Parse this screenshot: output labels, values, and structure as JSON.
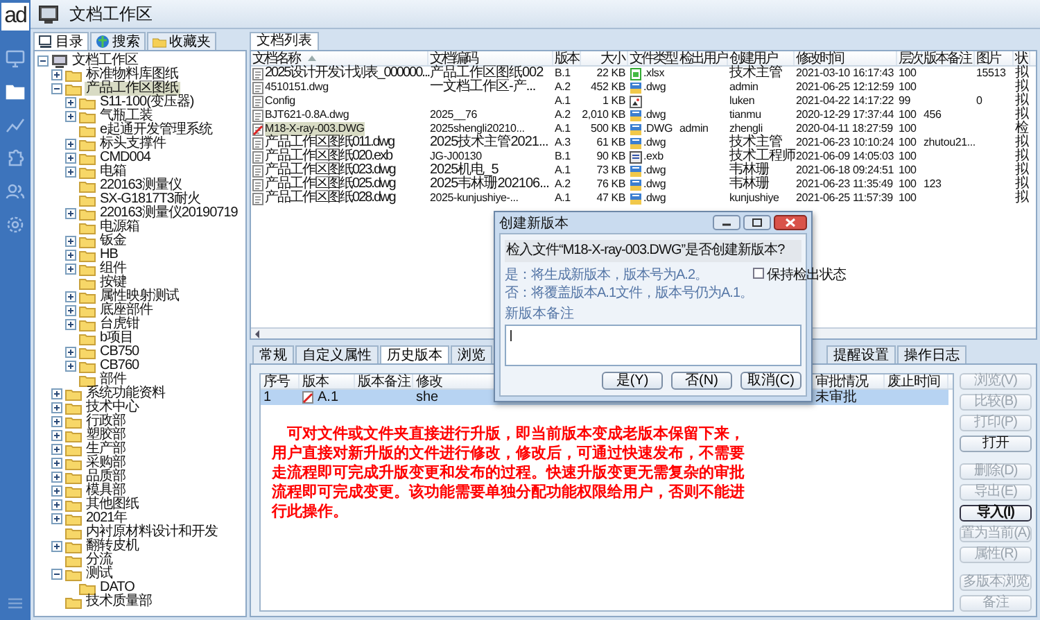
{
  "logo": "ad",
  "nav": [
    {
      "kind": "monitor",
      "selected": false
    },
    {
      "kind": "folder",
      "selected": true
    },
    {
      "kind": "chart",
      "selected": false
    },
    {
      "kind": "puzzle",
      "selected": false
    },
    {
      "kind": "users",
      "selected": false
    },
    {
      "kind": "gear",
      "selected": false
    }
  ],
  "window": {
    "title": "文档工作区"
  },
  "left_tabs": [
    {
      "label": "目录",
      "kind": "catalog",
      "selected": true
    },
    {
      "label": "搜索",
      "kind": "search",
      "selected": false
    },
    {
      "label": "收藏夹",
      "kind": "favorite",
      "selected": false
    }
  ],
  "tree": [
    {
      "label": "文档工作区",
      "kind": "root",
      "expanded": true,
      "selected": false,
      "children": [
        {
          "label": "标准物料库图纸",
          "expanded": false,
          "selected": false
        },
        {
          "label": "产品工作区图纸",
          "expanded": true,
          "selected": true,
          "children": [
            {
              "label": "S11-100(变压器)",
              "expanded": false,
              "selected": false
            },
            {
              "label": "气瓶工装",
              "expanded": false,
              "selected": false
            },
            {
              "label": "e起通开发管理系统",
              "selected": false
            },
            {
              "label": "标头支撑件",
              "expanded": false,
              "selected": false
            },
            {
              "label": "CMD004",
              "expanded": false,
              "selected": false
            },
            {
              "label": "电箱",
              "expanded": false,
              "selected": false
            },
            {
              "label": "220163测量仪",
              "selected": false
            },
            {
              "label": "SX-G1817T3耐火",
              "selected": false
            },
            {
              "label": "220163测量仪20190719",
              "expanded": false,
              "selected": false
            },
            {
              "label": "电源箱",
              "selected": false
            },
            {
              "label": "钣金",
              "expanded": false,
              "selected": false
            },
            {
              "label": "HB",
              "expanded": false,
              "selected": false
            },
            {
              "label": "组件",
              "expanded": false,
              "selected": false
            },
            {
              "label": "按键",
              "selected": false
            },
            {
              "label": "属性映射测试",
              "expanded": false,
              "selected": false
            },
            {
              "label": "底座部件",
              "expanded": false,
              "selected": false
            },
            {
              "label": "台虎钳",
              "expanded": false,
              "selected": false
            },
            {
              "label": "b项目",
              "selected": false
            },
            {
              "label": "CB750",
              "expanded": false,
              "selected": false
            },
            {
              "label": "CB760",
              "expanded": false,
              "selected": false
            },
            {
              "label": "部件",
              "selected": false
            }
          ]
        },
        {
          "label": "系统功能资料",
          "expanded": false,
          "selected": false
        },
        {
          "label": "技术中心",
          "expanded": false,
          "selected": false
        },
        {
          "label": "行政部",
          "expanded": false,
          "selected": false
        },
        {
          "label": "塑胶部",
          "expanded": false,
          "selected": false
        },
        {
          "label": "生产部",
          "expanded": false,
          "selected": false
        },
        {
          "label": "采购部",
          "expanded": false,
          "selected": false
        },
        {
          "label": "品质部",
          "expanded": false,
          "selected": false
        },
        {
          "label": "模具部",
          "expanded": false,
          "selected": false
        },
        {
          "label": "其他图纸",
          "expanded": false,
          "selected": false
        },
        {
          "label": "2021年",
          "expanded": false,
          "selected": false
        },
        {
          "label": "内衬原材料设计和开发",
          "selected": false
        },
        {
          "label": "翻转皮机",
          "expanded": false,
          "selected": false
        },
        {
          "label": "分流",
          "selected": false
        },
        {
          "label": "测试",
          "expanded": true,
          "selected": false,
          "children": [
            {
              "label": "DATO",
              "selected": false
            }
          ]
        },
        {
          "label": "技术质量部",
          "selected": false
        }
      ]
    }
  ],
  "list_tab": {
    "label": "文档列表"
  },
  "file_table": {
    "columns": [
      "文档名称",
      "文档编码",
      "版本",
      "大小",
      "文件类型",
      "检出用户",
      "创建用户",
      "修改时间",
      "层次",
      "版本备注",
      "图片",
      "状"
    ],
    "rows": [
      {
        "doc_name": "2025设计开发计划表_000000...",
        "doc_code": "产品工作区图纸002",
        "version": "B.1",
        "size": "22 KB",
        "kind": "excel",
        "file_type": ".xlsx",
        "creator": "技术主管",
        "modified": "2021-03-10 16:17:43",
        "tier": "100",
        "image": "15513",
        "column_12": "拟",
        "checked_out": false,
        "selected": false
      },
      {
        "doc_name": "4510151.dwg",
        "doc_code": "一文档工作区-产...",
        "version": "A.2",
        "size": "452 KB",
        "kind": "dwg",
        "file_type": ".dwg",
        "creator": "admin",
        "modified": "2021-06-25 12:12:59",
        "tier": "100",
        "column_12": "拟",
        "checked_out": false,
        "selected": false
      },
      {
        "doc_name": "Config",
        "version": "A.1",
        "size": "1 KB",
        "kind": "image",
        "creator": "luken",
        "modified": "2021-04-22 14:17:22",
        "tier": "99",
        "image": "0",
        "column_12": "拟",
        "checked_out": false,
        "selected": false
      },
      {
        "doc_name": "BJT621-0.8A.dwg",
        "doc_code": "2025__76",
        "version": "A.2",
        "size": "2,010 KB",
        "kind": "dwg",
        "file_type": ".dwg",
        "creator": "tianmu",
        "modified": "2020-12-29 17:37:44",
        "tier": "100",
        "version_note": "456",
        "column_12": "拟",
        "checked_out": false,
        "selected": false
      },
      {
        "doc_name": "M18-X-ray-003.DWG",
        "doc_code": "2025shengli20210...",
        "version": "A.1",
        "size": "500 KB",
        "kind": "dwg",
        "file_type": ".DWG",
        "checkout_user": "admin",
        "creator": "zhengli",
        "modified": "2020-04-11 18:27:59",
        "tier": "100",
        "column_12": "检",
        "checked_out": true,
        "selected": true
      },
      {
        "doc_name": "产品工作区图纸011.dwg",
        "doc_code": "2025技术主管2021...",
        "version": "A.3",
        "size": "61 KB",
        "kind": "dwg",
        "file_type": ".dwg",
        "creator": "技术主管",
        "modified": "2021-06-23 10:10:24",
        "tier": "100",
        "version_note": "zhutou21...",
        "column_12": "拟",
        "checked_out": false,
        "selected": false
      },
      {
        "doc_name": "产品工作区图纸020.exb",
        "doc_code": "JG-J00130",
        "version": "B.1",
        "size": "90 KB",
        "kind": "exb",
        "file_type": ".exb",
        "creator": "技术工程师",
        "modified": "2021-06-09 14:05:03",
        "tier": "100",
        "column_12": "拟",
        "checked_out": false,
        "selected": false
      },
      {
        "doc_name": "产品工作区图纸023.dwg",
        "doc_code": "2025机电_5",
        "version": "A.1",
        "size": "73 KB",
        "kind": "dwg",
        "file_type": ".dwg",
        "creator": "韦林珊",
        "modified": "2021-06-18 09:24:51",
        "tier": "100",
        "column_12": "拟",
        "checked_out": false,
        "selected": false
      },
      {
        "doc_name": "产品工作区图纸025.dwg",
        "doc_code": "2025韦林珊202106...",
        "version": "A.2",
        "size": "76 KB",
        "kind": "dwg",
        "file_type": ".dwg",
        "creator": "韦林珊",
        "modified": "2021-06-23 11:35:49",
        "tier": "100",
        "version_note": "123",
        "column_12": "拟",
        "checked_out": false,
        "selected": false
      },
      {
        "doc_name": "产品工作区图纸028.dwg",
        "doc_code": "2025-kunjushiye-...",
        "version": "A.1",
        "size": "47 KB",
        "kind": "dwg",
        "file_type": ".dwg",
        "creator": "kunjushiye",
        "modified": "2021-06-25 11:57:39",
        "tier": "100",
        "column_12": "拟",
        "checked_out": false,
        "selected": false
      }
    ]
  },
  "detail_tabs": [
    {
      "label": "常规",
      "selected": false
    },
    {
      "label": "自定义属性",
      "selected": false
    },
    {
      "label": "历史版本",
      "selected": true
    },
    {
      "label": "浏览",
      "selected": false
    },
    {
      "label": "提醒设置",
      "selected": false
    },
    {
      "label": "操作日志",
      "selected": false
    }
  ],
  "history_table": {
    "columns": [
      "序号",
      "版本",
      "版本备注",
      "修改",
      "审批情况",
      "废止时间"
    ],
    "rows": [
      {
        "index": "1",
        "version": "A.1",
        "column_4": "she",
        "approval": "未审批",
        "selected": true
      }
    ]
  },
  "annotation": "可对文件或文件夹直接进行升版，即当前版本变成老版本保留下来，用户直接对新升版的文件进行修改，修改后，可通过快速发布，不需要走流程即可完成升版变更和发布的过程。快速升版变更无需复杂的审批流程即可完成变更。该功能需要单独分配功能权限给用户，否则不能进行此操作。",
  "side_buttons": [
    [
      {
        "label": "浏览(V)",
        "disabled": true,
        "focused": false
      },
      {
        "label": "比较(B)",
        "disabled": true,
        "focused": false
      },
      {
        "label": "打印(P)",
        "disabled": true,
        "focused": false
      },
      {
        "label": "打开",
        "disabled": false,
        "focused": false
      }
    ],
    [
      {
        "label": "删除(D)",
        "disabled": true,
        "focused": false
      },
      {
        "label": "导出(E)",
        "disabled": true,
        "focused": false
      },
      {
        "label": "导入(I)",
        "disabled": false,
        "focused": true
      },
      {
        "label": "置为当前(A)",
        "disabled": true,
        "focused": false
      },
      {
        "label": "属性(R)",
        "disabled": true,
        "focused": false
      }
    ],
    [
      {
        "label": "多版本浏览",
        "disabled": true,
        "focused": false
      },
      {
        "label": "备注",
        "disabled": true,
        "focused": false
      }
    ]
  ],
  "dialog": {
    "title": "创建新版本",
    "prompt": "检入文件“M18-X-ray-003.DWG”是否创建新版本?",
    "yes_note": "是：将生成新版本，版本号为A.2。",
    "no_note": "否：将覆盖版本A.1文件，版本号仍为A.1。",
    "keep_checkout": {
      "label": "保持检出状态",
      "checked": false
    },
    "note_label": "新版本备注",
    "buttons": [
      "是(Y)",
      "否(N)",
      "取消(C)"
    ]
  }
}
